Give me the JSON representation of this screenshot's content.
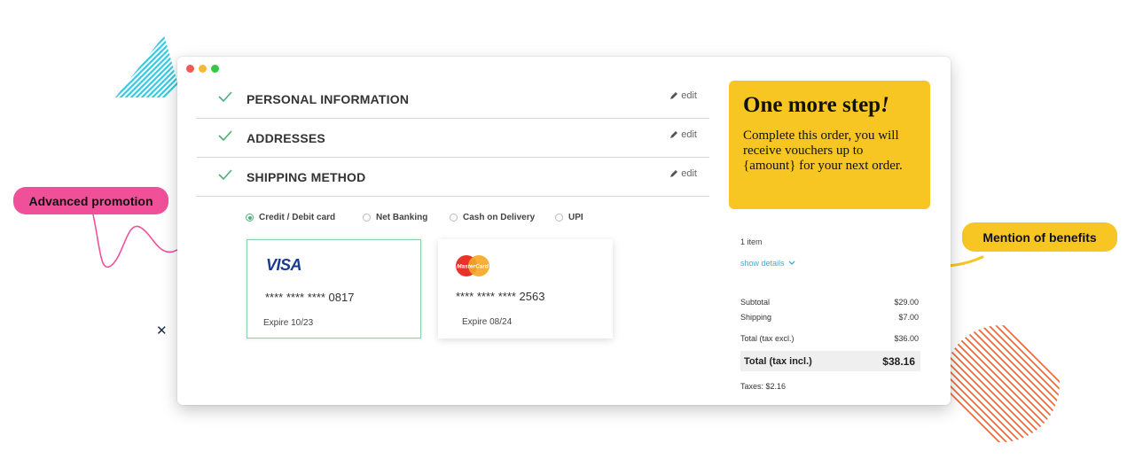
{
  "window": {
    "dots": [
      "#f15a55",
      "#f5b93a",
      "#34c748"
    ]
  },
  "steps": [
    {
      "title": "PERSONAL INFORMATION",
      "edit": "edit"
    },
    {
      "title": "ADDRESSES",
      "edit": "edit"
    },
    {
      "title": "SHIPPING METHOD",
      "edit": "edit"
    }
  ],
  "payment_options": [
    {
      "label": "Credit / Debit card",
      "selected": true
    },
    {
      "label": "Net Banking",
      "selected": false
    },
    {
      "label": "Cash on Delivery",
      "selected": false
    },
    {
      "label": "UPI",
      "selected": false
    }
  ],
  "cards": [
    {
      "brand": "VISA",
      "number": "**** **** ****  0817",
      "expire": "Expire 10/23"
    },
    {
      "brand": "MasterCard",
      "number": "**** **** ****  2563",
      "expire": "Expire 08/24"
    }
  ],
  "promo": {
    "heading": "One more step",
    "heading_suffix": "!",
    "body": "Complete this order, you will receive vouchers up to {amount} for your next order."
  },
  "summary": {
    "items": "1 item",
    "show_details": "show details",
    "subtotal_label": "Subtotal",
    "subtotal": "$29.00",
    "shipping_label": "Shipping",
    "shipping": "$7.00",
    "total_excl_label": "Total (tax excl.)",
    "total_excl": "$36.00",
    "total_incl_label": "Total (tax incl.)",
    "total_incl": "$38.16",
    "taxes": "Taxes: $2.16"
  },
  "annotations": {
    "left": "Advanced promotion",
    "right": "Mention of benefits"
  },
  "colors": {
    "accent_green": "#4caf79",
    "promo_yellow": "#f7c623",
    "pink": "#f0509a",
    "cyan": "#3cc9dc",
    "orange": "#f26a3d"
  }
}
